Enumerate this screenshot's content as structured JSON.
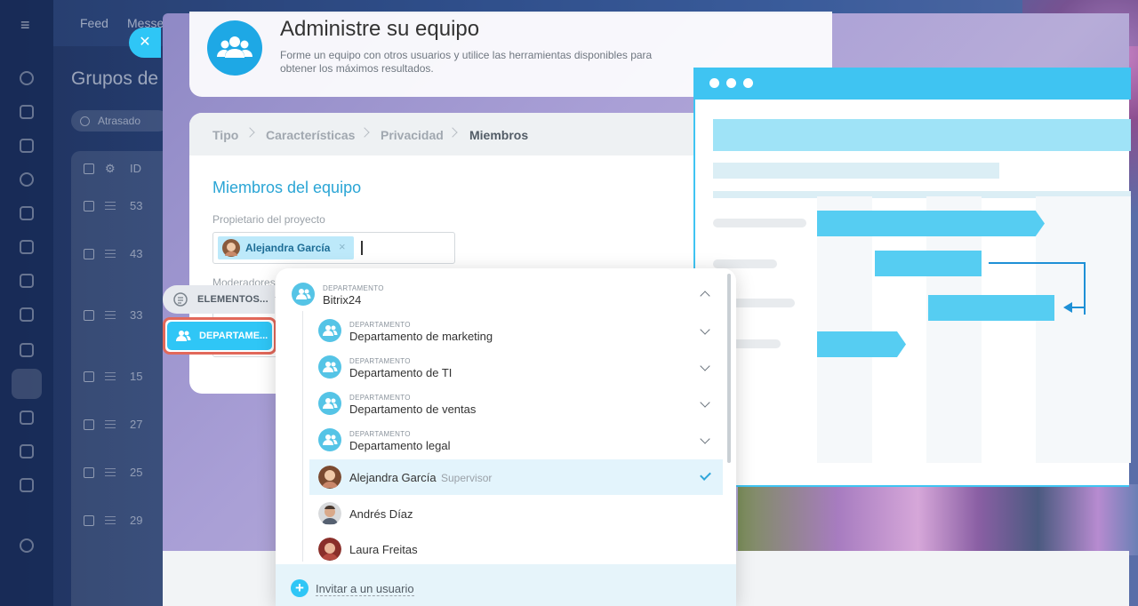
{
  "nav": {
    "feed": "Feed",
    "messenger": "Messe",
    "page_title": "Grupos de",
    "filter": "Atrasado"
  },
  "table": {
    "header_id": "ID",
    "rows": [
      "53",
      "43",
      "33",
      "15",
      "27",
      "25",
      "29"
    ]
  },
  "slider": {
    "title": "Administre su equipo",
    "subtitle": "Forme un equipo con otros usuarios y utilice las herramientas disponibles para obtener los máximos resultados.",
    "steps": [
      "Tipo",
      "Características",
      "Privacidad",
      "Miembros"
    ],
    "form_title": "Miembros del equipo",
    "owner_label": "Propietario del proyecto",
    "owner_tag": "Alejandra García",
    "tag_remove": "×",
    "moderators_label": "Moderadores"
  },
  "selector": {
    "tabs": [
      {
        "label": "ELEMENTOS...",
        "icon": "search-list-icon"
      },
      {
        "label": "DEPARTAME...",
        "icon": "users-icon"
      }
    ],
    "dept_caption": "DEPARTAMENTO",
    "root": "Bitrix24",
    "departments": [
      "Departamento de marketing",
      "Departamento de TI",
      "Departamento de ventas",
      "Departamento legal"
    ],
    "users": [
      {
        "name": "Alejandra García",
        "role": "Supervisor",
        "selected": true
      },
      {
        "name": "Andrés Díaz",
        "role": "",
        "selected": false
      },
      {
        "name": "Laura Freitas",
        "role": "",
        "selected": false
      }
    ],
    "invite": "Invitar a un usuario"
  },
  "colors": {
    "accent": "#2fc6f6",
    "highlight_border": "#e2685a",
    "selected_row": "#e3f4fc"
  }
}
